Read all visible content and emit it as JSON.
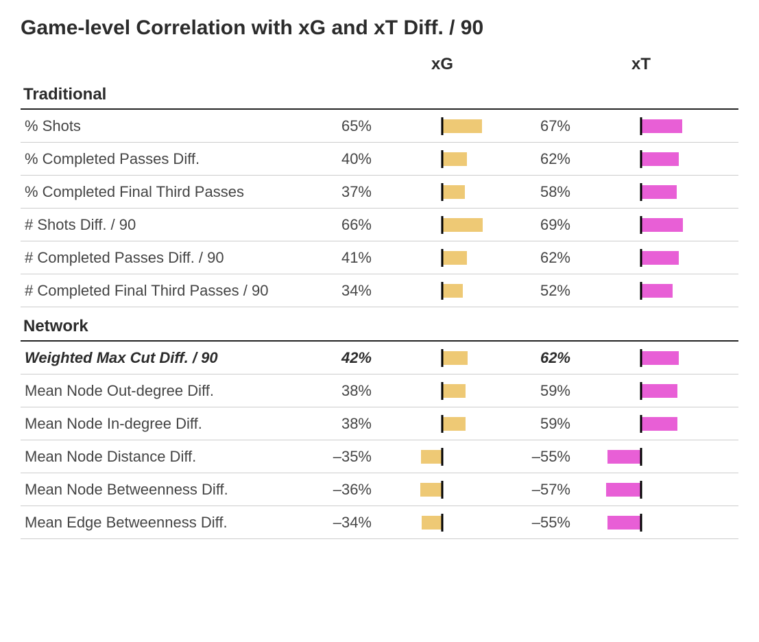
{
  "title": "Game-level Correlation with xG and xT Diff. / 90",
  "columns": {
    "xg": "xG",
    "xt": "xT"
  },
  "colors": {
    "xg_bar": "#eec975",
    "xt_bar": "#e85fd6",
    "axis": "#000000"
  },
  "groups": [
    {
      "name": "Traditional",
      "rows": [
        {
          "label": "% Shots",
          "xg": 65,
          "xt": 67,
          "emph": false
        },
        {
          "label": "% Completed Passes Diff.",
          "xg": 40,
          "xt": 62,
          "emph": false
        },
        {
          "label": "% Completed Final Third Passes",
          "xg": 37,
          "xt": 58,
          "emph": false
        },
        {
          "label": "# Shots Diff. / 90",
          "xg": 66,
          "xt": 69,
          "emph": false
        },
        {
          "label": "# Completed Passes Diff. / 90",
          "xg": 41,
          "xt": 62,
          "emph": false
        },
        {
          "label": "# Completed Final Third Passes / 90",
          "xg": 34,
          "xt": 52,
          "emph": false
        }
      ]
    },
    {
      "name": "Network",
      "rows": [
        {
          "label": "Weighted Max Cut Diff. / 90",
          "xg": 42,
          "xt": 62,
          "emph": true
        },
        {
          "label": "Mean Node Out-degree Diff.",
          "xg": 38,
          "xt": 59,
          "emph": false
        },
        {
          "label": "Mean Node In-degree Diff.",
          "xg": 38,
          "xt": 59,
          "emph": false
        },
        {
          "label": "Mean Node Distance Diff.",
          "xg": -35,
          "xt": -55,
          "emph": false
        },
        {
          "label": "Mean Node Betweenness Diff.",
          "xg": -36,
          "xt": -57,
          "emph": false
        },
        {
          "label": "Mean Edge Betweenness Diff.",
          "xg": -34,
          "xt": -55,
          "emph": false
        }
      ]
    }
  ],
  "chart_data": {
    "type": "table",
    "title": "Game-level Correlation with xG and xT Diff. / 90",
    "x": [
      "xG",
      "xT"
    ],
    "categories": [
      "% Shots",
      "% Completed Passes Diff.",
      "% Completed Final Third Passes",
      "# Shots Diff. / 90",
      "# Completed Passes Diff. / 90",
      "# Completed Final Third Passes / 90",
      "Weighted Max Cut Diff. / 90",
      "Mean Node Out-degree Diff.",
      "Mean Node In-degree Diff.",
      "Mean Node Distance Diff.",
      "Mean Node Betweenness Diff.",
      "Mean Edge Betweenness Diff."
    ],
    "series": [
      {
        "name": "xG",
        "values": [
          65,
          40,
          37,
          66,
          41,
          34,
          42,
          38,
          38,
          -35,
          -36,
          -34
        ]
      },
      {
        "name": "xT",
        "values": [
          67,
          62,
          58,
          69,
          62,
          52,
          62,
          59,
          59,
          -55,
          -57,
          -55
        ]
      }
    ],
    "value_unit": "percent_correlation",
    "group_assignment": [
      "Traditional",
      "Traditional",
      "Traditional",
      "Traditional",
      "Traditional",
      "Traditional",
      "Network",
      "Network",
      "Network",
      "Network",
      "Network",
      "Network"
    ],
    "bar_axis_range": [
      -100,
      100
    ]
  }
}
